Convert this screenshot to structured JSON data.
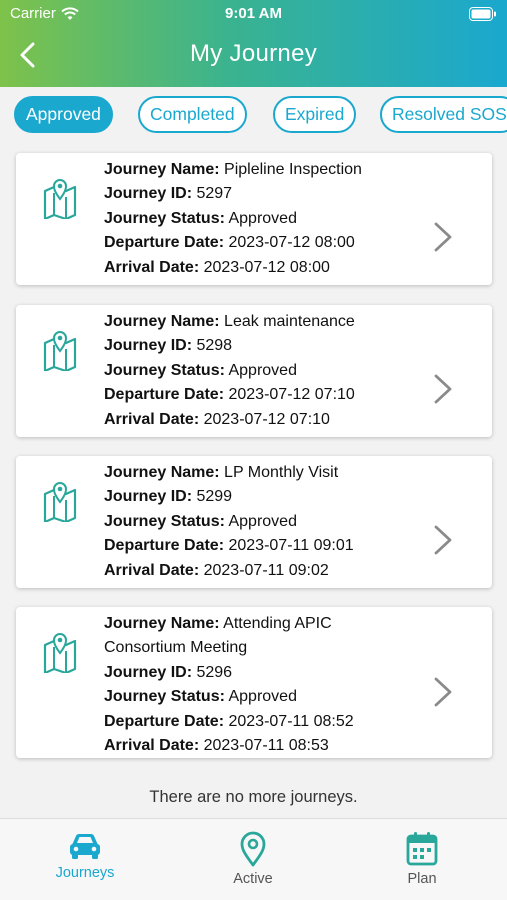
{
  "status_bar": {
    "carrier": "Carrier",
    "time": "9:01 AM"
  },
  "header": {
    "title": "My Journey"
  },
  "tabs": [
    {
      "label": "Approved",
      "active": true
    },
    {
      "label": "Completed",
      "active": false
    },
    {
      "label": "Expired",
      "active": false
    },
    {
      "label": "Resolved SOS",
      "active": false
    }
  ],
  "field_labels": {
    "name": "Journey Name:",
    "id": "Journey ID:",
    "status": "Journey Status:",
    "departure": "Departure Date:",
    "arrival": "Arrival Date:"
  },
  "journeys": [
    {
      "name": "Pipleline Inspection",
      "id": "5297",
      "status": "Approved",
      "departure": "2023-07-12 08:00",
      "arrival": "2023-07-12 08:00"
    },
    {
      "name": "Leak maintenance",
      "id": "5298",
      "status": "Approved",
      "departure": "2023-07-12 07:10",
      "arrival": "2023-07-12 07:10"
    },
    {
      "name": "LP Monthly Visit",
      "id": "5299",
      "status": "Approved",
      "departure": "2023-07-11 09:01",
      "arrival": "2023-07-11 09:02"
    },
    {
      "name": "Attending APIC Consortium Meeting",
      "id": "5296",
      "status": "Approved",
      "departure": "2023-07-11 08:52",
      "arrival": "2023-07-11 08:53"
    }
  ],
  "end_message": "There are no more journeys.",
  "tabbar": {
    "journeys": "Journeys",
    "active": "Active",
    "plan": "Plan"
  },
  "colors": {
    "accent": "#1aa8cf",
    "gradient_start": "#7ec24a",
    "icon_teal": "#2aa79b"
  }
}
